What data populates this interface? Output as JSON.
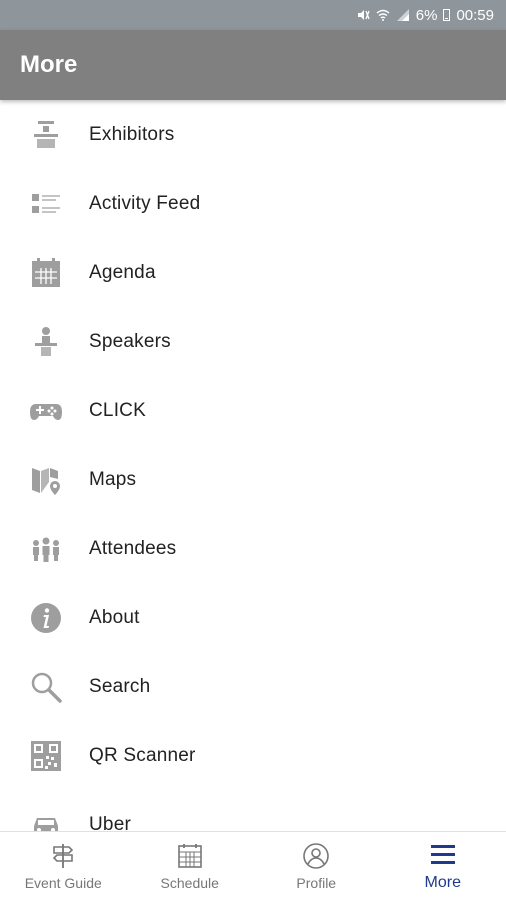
{
  "status_bar": {
    "battery": "6%",
    "time": "00:59",
    "icons": [
      "mute-vibrate-icon",
      "wifi-icon",
      "signal-icon",
      "battery-icon"
    ]
  },
  "app_bar": {
    "title": "More"
  },
  "menu": {
    "items": [
      {
        "label": "Exhibitors",
        "icon": "exhibitor-booth-icon"
      },
      {
        "label": "Activity Feed",
        "icon": "activity-list-icon"
      },
      {
        "label": "Agenda",
        "icon": "calendar-icon"
      },
      {
        "label": "Speakers",
        "icon": "speaker-podium-icon"
      },
      {
        "label": "CLICK",
        "icon": "gamepad-icon"
      },
      {
        "label": "Maps",
        "icon": "map-pin-icon"
      },
      {
        "label": "Attendees",
        "icon": "people-icon"
      },
      {
        "label": "About",
        "icon": "info-icon"
      },
      {
        "label": "Search",
        "icon": "search-icon"
      },
      {
        "label": "QR Scanner",
        "icon": "qr-code-icon"
      },
      {
        "label": "Uber",
        "icon": "car-icon"
      }
    ]
  },
  "bottom_nav": {
    "tabs": [
      {
        "label": "Event Guide",
        "icon": "signpost-icon",
        "active": false
      },
      {
        "label": "Schedule",
        "icon": "calendar-icon",
        "active": false
      },
      {
        "label": "Profile",
        "icon": "profile-icon",
        "active": false
      },
      {
        "label": "More",
        "icon": "hamburger-menu-icon",
        "active": true
      }
    ]
  },
  "colors": {
    "status_bar": "#8e959b",
    "app_bar": "#808080",
    "icon_gray": "#9e9e9e",
    "active_tab": "#1f3a8a",
    "inactive_tab": "#777777"
  }
}
